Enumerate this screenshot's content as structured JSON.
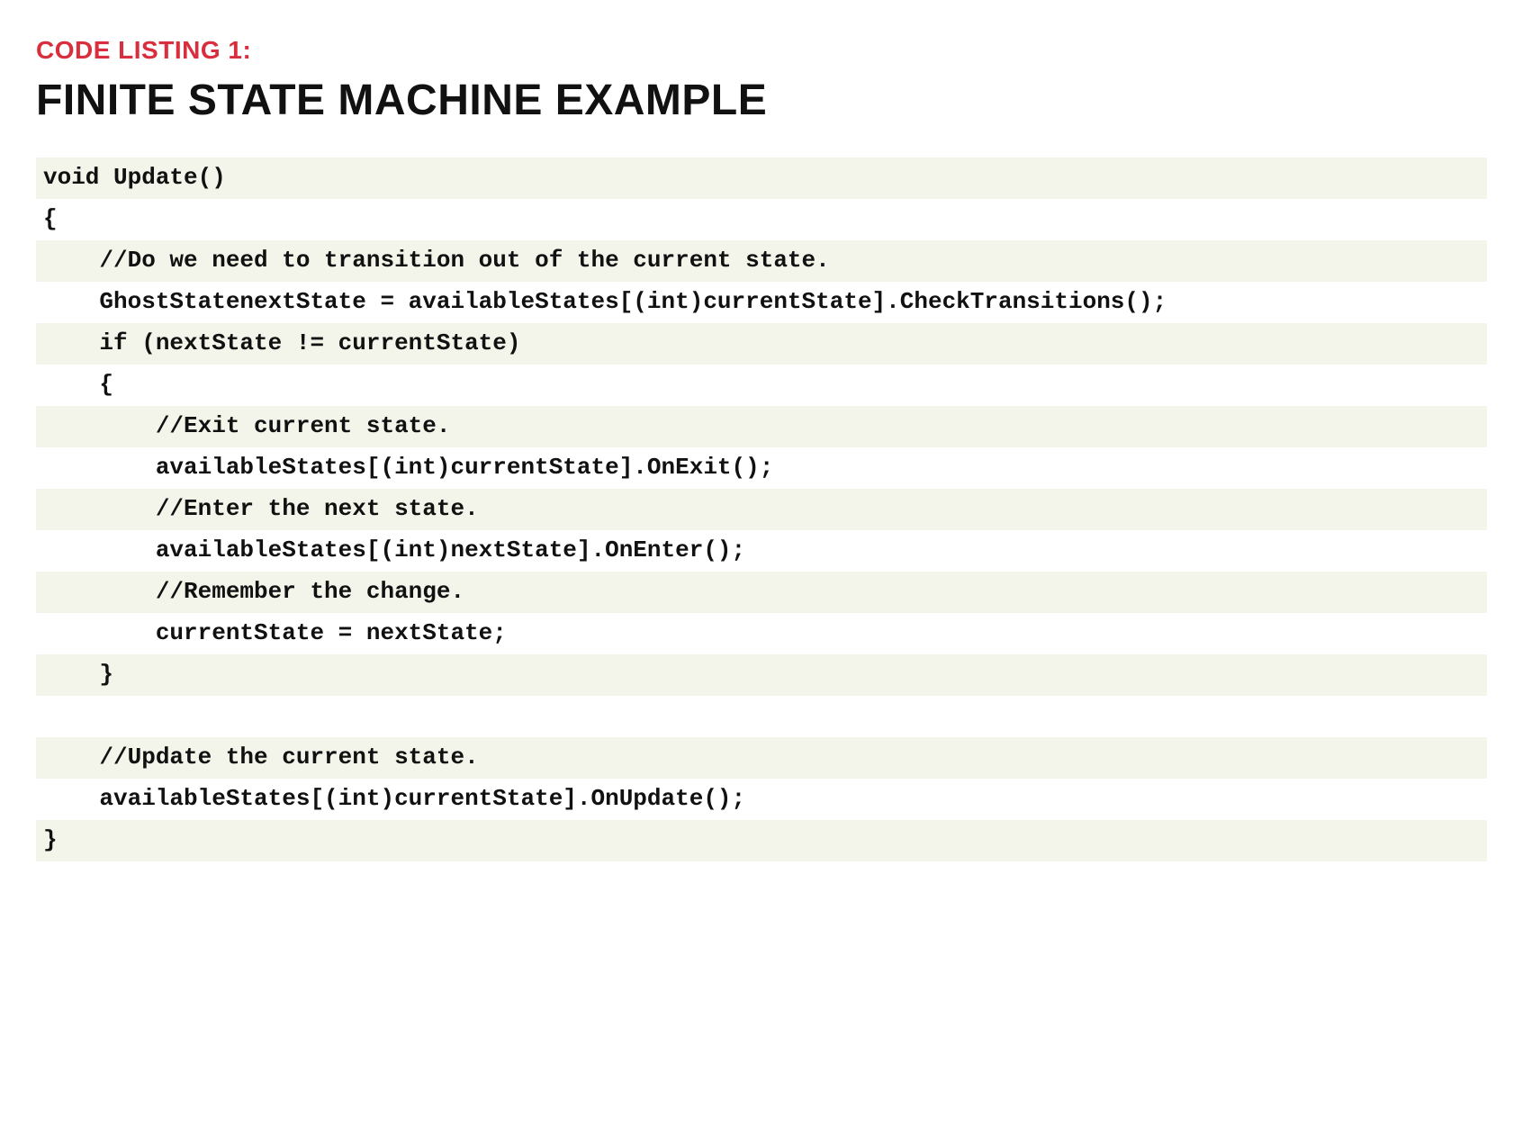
{
  "listing": {
    "label": "CODE LISTING 1:",
    "title": "FINITE STATE MACHINE EXAMPLE"
  },
  "code": {
    "lines": [
      "void Update()",
      "{",
      "    //Do we need to transition out of the current state.",
      "    GhostStatenextState = availableStates[(int)currentState].CheckTransitions();",
      "    if (nextState != currentState)",
      "    {",
      "        //Exit current state.",
      "        availableStates[(int)currentState].OnExit();",
      "        //Enter the next state.",
      "        availableStates[(int)nextState].OnEnter();",
      "        //Remember the change.",
      "        currentState = nextState;",
      "    }",
      "",
      "    //Update the current state.",
      "    availableStates[(int)currentState].OnUpdate();",
      "}"
    ]
  }
}
